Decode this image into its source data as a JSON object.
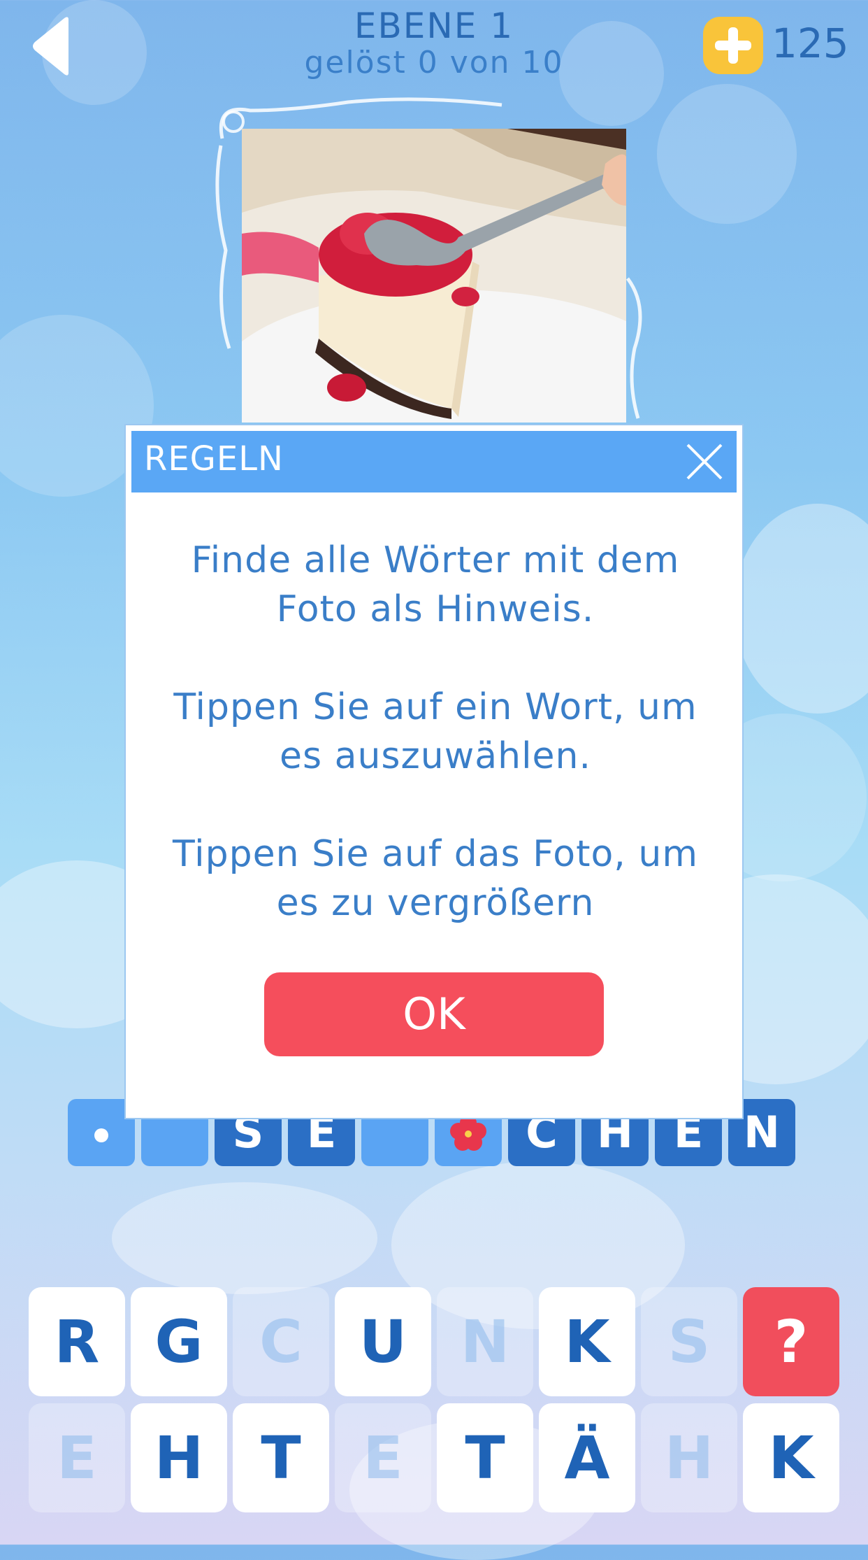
{
  "header": {
    "level_title": "EBENE 1",
    "level_progress": "gelöst 0 von 10",
    "coins": "125"
  },
  "icons": {
    "back": "back-arrow-icon",
    "coins": "plus-coin-icon",
    "close": "close-icon",
    "dot": "dot-icon",
    "hibiscus": "hibiscus-icon"
  },
  "colors": {
    "accent_blue": "#5aa7f5",
    "tile_blue": "#2b6fc5",
    "hint_red": "#f14e5c",
    "coin_yellow": "#f9c43a"
  },
  "answer": {
    "slots": [
      "",
      "",
      "S",
      "E",
      "",
      "",
      "C",
      "H",
      "E",
      "N"
    ]
  },
  "keyboard": {
    "row1": [
      "R",
      "G",
      "C",
      "U",
      "N",
      "K",
      "S",
      "?"
    ],
    "row2": [
      "E",
      "H",
      "T",
      "E",
      "T",
      "Ä",
      "H",
      "K"
    ]
  },
  "modal": {
    "title": "REGELN",
    "rule1": "Finde alle Wörter mit dem Foto als Hinweis.",
    "rule2": "Tippen Sie auf ein Wort, um es auszuwählen.",
    "rule3": "Tippen Sie auf das Foto, um es zu vergrößern",
    "ok_label": "OK"
  }
}
